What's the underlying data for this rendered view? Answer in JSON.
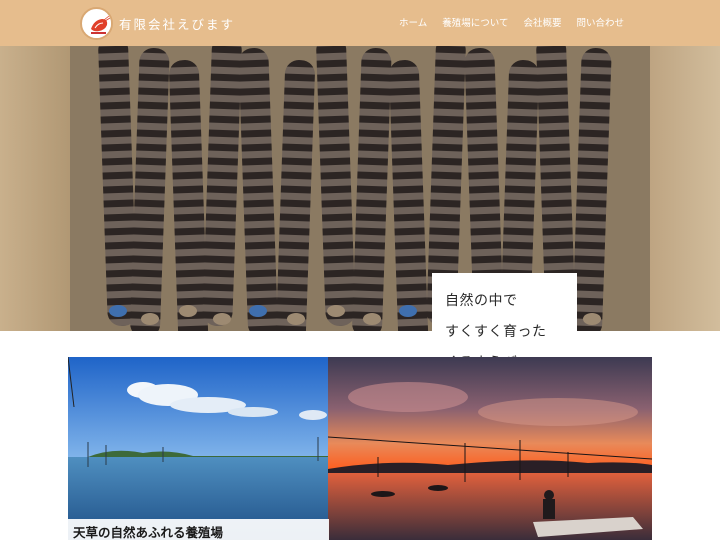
{
  "header": {
    "logo_icon": "ebimasu-logo-icon",
    "brand": "有限会社えびます",
    "background": "#e6bd8d"
  },
  "nav": {
    "items": [
      {
        "label": "ホーム"
      },
      {
        "label": "養殖場について"
      },
      {
        "label": "会社概要"
      },
      {
        "label": "問い合わせ"
      }
    ]
  },
  "hero": {
    "image": "kuruma-shrimp-in-box-photo",
    "caption_lines": [
      "自然の中で",
      "すくすく育った",
      "くるまえび"
    ]
  },
  "gallery": {
    "left_image": "amakusa-farm-daytime-photo",
    "right_image": "farm-sunset-photo",
    "left_caption": "天草の自然あふれる養殖場"
  }
}
